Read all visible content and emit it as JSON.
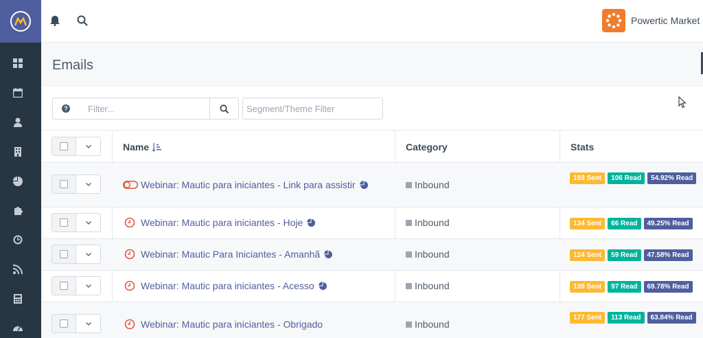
{
  "brand": {
    "name": "Powertic Market",
    "accent": "#4e5e9e",
    "logo_color": "#f07d2e"
  },
  "sidebar": {
    "icons": [
      "dashboard-icon",
      "calendar-icon",
      "contacts-icon",
      "companies-icon",
      "segments-icon",
      "components-icon",
      "campaigns-icon",
      "channels-icon",
      "reports-icon",
      "points-icon"
    ]
  },
  "topbar": {
    "icons": [
      "bell-icon",
      "search-icon"
    ]
  },
  "page": {
    "title": "Emails"
  },
  "filters": {
    "filter_placeholder": "Filter...",
    "segment_placeholder": "Segment/Theme Filter"
  },
  "table": {
    "headers": {
      "name": "Name",
      "category": "Category",
      "stats": "Stats"
    },
    "rows": [
      {
        "name": "Webinar: Mautic para iniciantes - Link para assistir",
        "status": "toggle-off",
        "category": "Inbound",
        "sent": "193 Sent",
        "read": "106 Read",
        "pct": "54.92% Read"
      },
      {
        "name": "Webinar: Mautic para iniciantes - Hoje",
        "status": "clock",
        "category": "Inbound",
        "sent": "134 Sent",
        "read": "66 Read",
        "pct": "49.25% Read"
      },
      {
        "name": "Webinar: Mautic Para Iniciantes - Amanhã",
        "status": "clock",
        "category": "Inbound",
        "sent": "124 Sent",
        "read": "59 Read",
        "pct": "47.58% Read"
      },
      {
        "name": "Webinar: Mautic para iniciantes - Acesso",
        "status": "clock",
        "category": "Inbound",
        "sent": "139 Sent",
        "read": "97 Read",
        "pct": "69.78% Read"
      },
      {
        "name": "Webinar: Mautic para iniciantes - Obrigado",
        "status": "clock",
        "category": "Inbound",
        "sent": "177 Sent",
        "read": "113 Read",
        "pct": "63.84% Read"
      }
    ]
  },
  "colors": {
    "sent": "#fdb933",
    "read": "#00b49c",
    "pct": "#4e5e9e",
    "status_icon": "#e2553d"
  }
}
